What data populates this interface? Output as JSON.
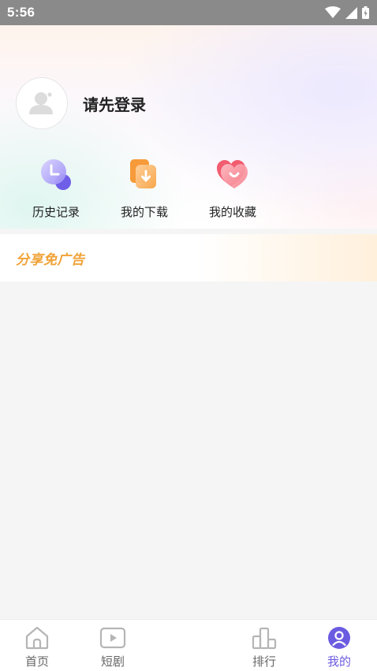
{
  "status_bar": {
    "time": "5:56",
    "icons": [
      "wifi-icon",
      "cell-signal-icon",
      "battery-icon"
    ]
  },
  "profile": {
    "login_prompt": "请先登录",
    "avatar_icon": "default-avatar-icon"
  },
  "quick_actions": [
    {
      "label": "历史记录",
      "icon": "history-clock-icon",
      "color": "#7b6cf0"
    },
    {
      "label": "我的下载",
      "icon": "download-icon",
      "color": "#f7a13f"
    },
    {
      "label": "我的收藏",
      "icon": "heart-favorite-icon",
      "color": "#f25c6f"
    }
  ],
  "banner": {
    "text": "分享免广告"
  },
  "bottom_nav": {
    "items": [
      {
        "label": "首页",
        "icon": "home-icon",
        "active": false
      },
      {
        "label": "短剧",
        "icon": "play-video-icon",
        "active": false
      },
      {
        "label": "排行",
        "icon": "ranking-bars-icon",
        "active": false
      },
      {
        "label": "我的",
        "icon": "user-profile-icon",
        "active": true
      }
    ],
    "active_color": "#6b5be0",
    "inactive_color": "#666666"
  }
}
